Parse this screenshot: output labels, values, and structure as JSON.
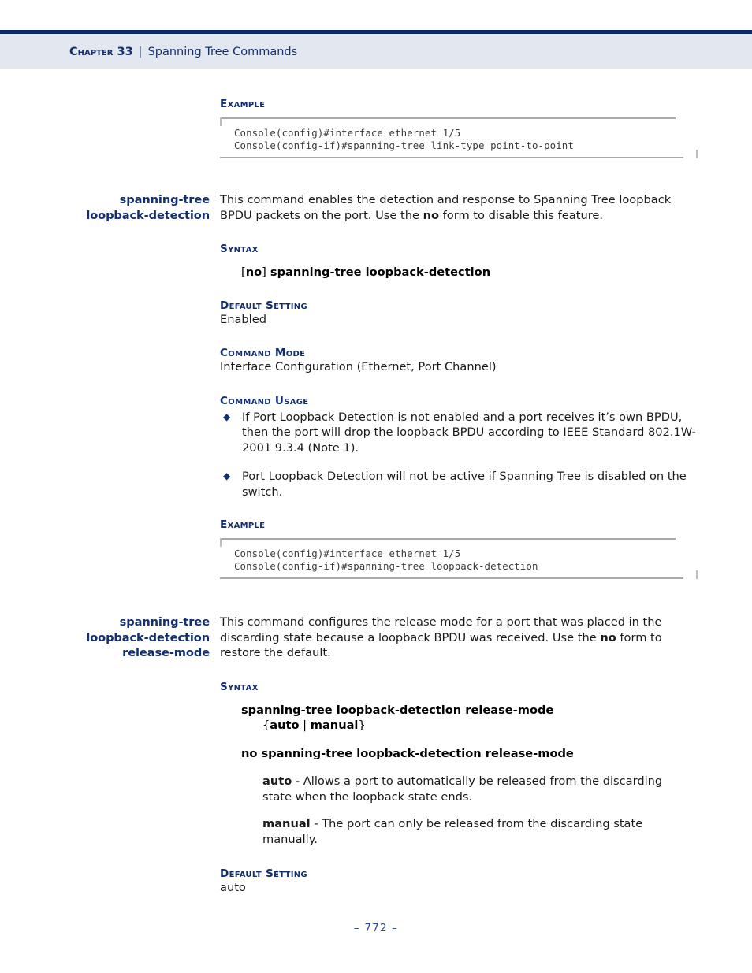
{
  "header": {
    "chapter": "Chapter 33",
    "separator": "|",
    "title": "Spanning Tree Commands"
  },
  "footer": {
    "page_label": "–  772  –"
  },
  "labels": {
    "example": "Example",
    "syntax": "Syntax",
    "default_setting": "Default Setting",
    "command_mode": "Command Mode",
    "command_usage": "Command Usage"
  },
  "example_top": {
    "label": "Example",
    "lines": [
      "Console(config)#interface ethernet 1/5",
      "Console(config-if)#spanning-tree link-type point-to-point"
    ]
  },
  "section_loopback_detection": {
    "margin_heading_lines": [
      "spanning-tree",
      "loopback-detection"
    ],
    "description_pre": "This command enables the detection and response to Spanning Tree loopback BPDU packets on the port. Use the ",
    "description_bold": "no",
    "description_post": " form to disable this feature.",
    "syntax_label": "Syntax",
    "syntax_open_bracket": "[",
    "syntax_no": "no",
    "syntax_close_bracket": "]",
    "syntax_command": " spanning-tree loopback-detection",
    "default_setting_label": "Default Setting",
    "default_setting_value": "Enabled",
    "command_mode_label": "Command Mode",
    "command_mode_value": "Interface Configuration (Ethernet, Port Channel)",
    "command_usage_label": "Command Usage",
    "usage_bullets": [
      "If Port Loopback Detection is not enabled and a port receives it’s own BPDU, then the port will drop the loopback BPDU according to IEEE Standard 802.1W-2001 9.3.4 (Note 1).",
      "Port Loopback Detection will not be active if Spanning Tree is disabled on the switch."
    ],
    "bullet_glyph": "◆",
    "example_label": "Example",
    "example_lines": [
      "Console(config)#interface ethernet 1/5",
      "Console(config-if)#spanning-tree loopback-detection"
    ]
  },
  "section_release_mode": {
    "margin_heading_lines": [
      "spanning-tree",
      "loopback-detection",
      "release-mode"
    ],
    "description_pre": "This command configures the release mode for a port that was placed in the discarding state because a loopback BPDU was received. Use the ",
    "description_bold": "no",
    "description_post": " form to restore the default.",
    "syntax_label": "Syntax",
    "syntax_line1": "spanning-tree loopback-detection release-mode",
    "syntax_line2_open": "{",
    "syntax_line2_auto": "auto",
    "syntax_line2_pipe": " | ",
    "syntax_line2_manual": "manual",
    "syntax_line2_close": "}",
    "syntax_line3": "no spanning-tree loopback-detection release-mode",
    "params": [
      {
        "name": "auto",
        "text": " - Allows a port to automatically be released from the discarding state when the loopback state ends."
      },
      {
        "name": "manual",
        "text": " - The port can only be released from the discarding state manually."
      }
    ],
    "default_setting_label": "Default Setting",
    "default_setting_value": "auto"
  },
  "colors": {
    "navy_rule": "#0a2b6b",
    "header_band": "#e3e7ef",
    "heading_blue": "#13306e",
    "footer_blue": "#2b4a86",
    "code_text": "#3a3a3a"
  }
}
